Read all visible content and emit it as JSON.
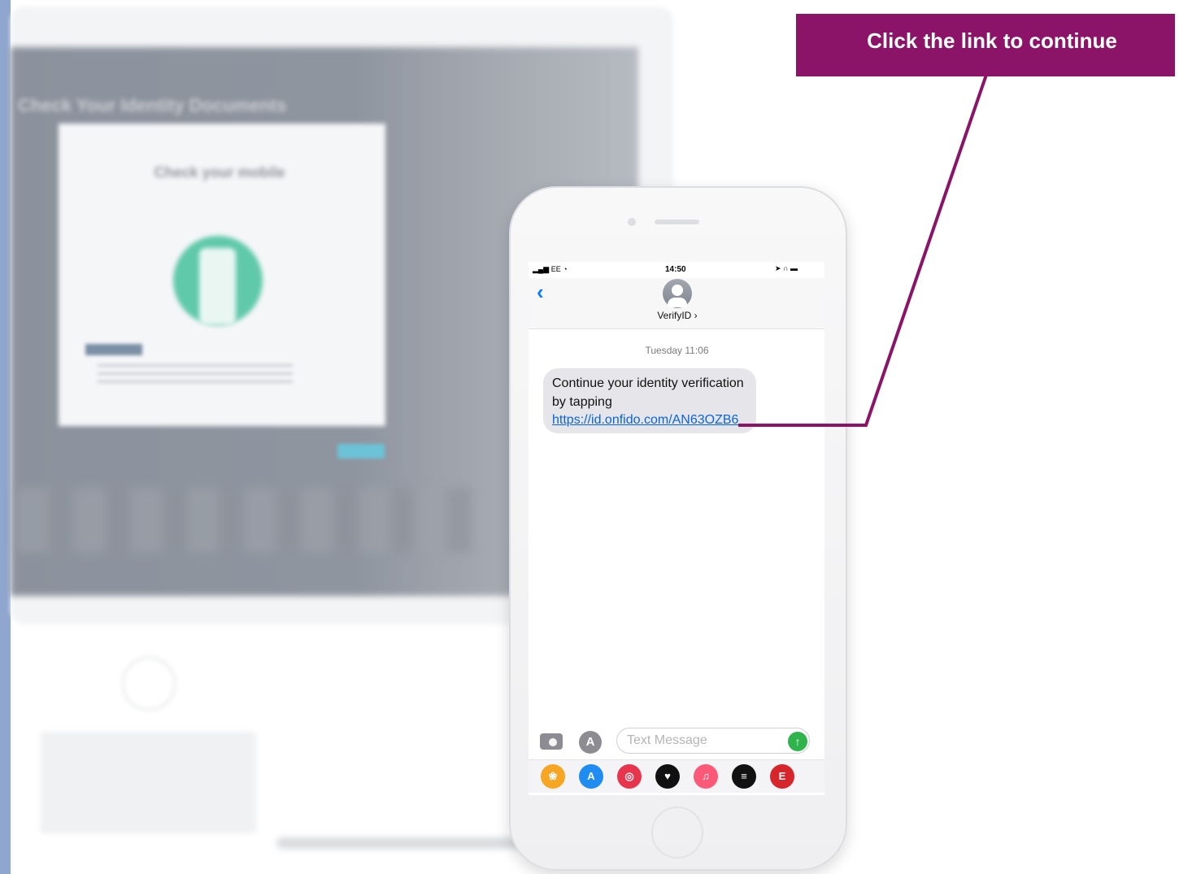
{
  "callout": {
    "text": "Click the link to continue",
    "color": "#8b1468"
  },
  "background_monitor": {
    "title": "Check Your Identity Documents",
    "modal_title": "Check your mobile",
    "screen_color": "#8c929d",
    "accent_circle_color": "#5fc9a9"
  },
  "phone": {
    "status_bar": {
      "carrier": "EE",
      "time": "14:50",
      "signal_icon": "signal-bars-icon",
      "wifi_icon": "wifi-icon",
      "battery_icon": "battery-icon"
    },
    "header": {
      "back_icon": "chevron-left-icon",
      "contact_name": "VerifyID ›",
      "avatar_icon": "person-icon"
    },
    "conversation": {
      "timestamp": "Tuesday 11:06",
      "message_text": "Continue your identity verification by tapping ",
      "message_link": "https://id.onfido.com/AN63OZB6"
    },
    "composer": {
      "placeholder": "Text Message",
      "camera_icon": "camera-icon",
      "apps_icon": "app-store-icon",
      "send_icon": "arrow-up-icon"
    },
    "app_drawer": [
      {
        "name": "photos-icon",
        "glyph": "❀",
        "color": "#f6a623"
      },
      {
        "name": "app-store-icon",
        "glyph": "A",
        "color": "#1e8cf0"
      },
      {
        "name": "search-images-icon",
        "glyph": "◎",
        "color": "#e8344d"
      },
      {
        "name": "digital-touch-icon",
        "glyph": "♥",
        "color": "#111111"
      },
      {
        "name": "music-icon",
        "glyph": "♫",
        "color": "#fa5a78"
      },
      {
        "name": "spotify-icon",
        "glyph": "≡",
        "color": "#111111"
      },
      {
        "name": "espn-icon",
        "glyph": "E",
        "color": "#d7262b"
      }
    ]
  }
}
